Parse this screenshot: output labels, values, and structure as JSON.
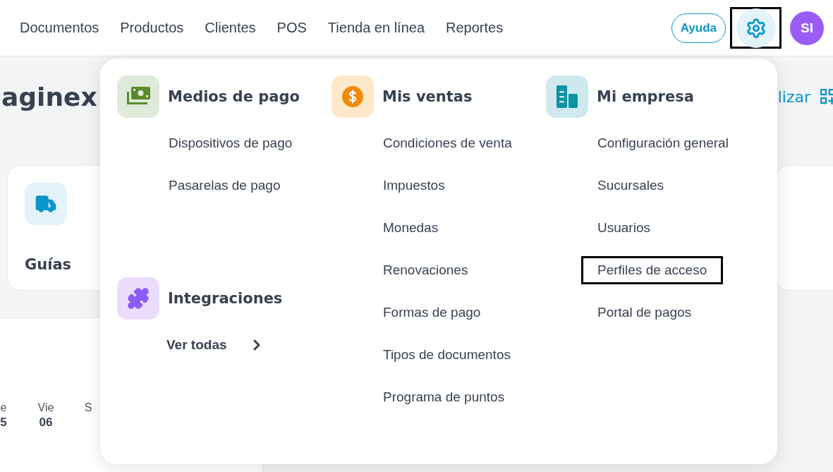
{
  "nav": {
    "links": [
      {
        "label": "Documentos"
      },
      {
        "label": "Productos"
      },
      {
        "label": "Clientes"
      },
      {
        "label": "POS"
      },
      {
        "label": "Tienda en línea"
      },
      {
        "label": "Reportes"
      }
    ],
    "help_button": "Ayuda",
    "settings": {
      "highlighted": true
    },
    "avatar": "SI"
  },
  "page": {
    "title": "aginex",
    "action": "lizar",
    "card": {
      "label": "Guías"
    },
    "days": [
      {
        "day": "e",
        "num": "5"
      },
      {
        "day": "Vie",
        "num": "06"
      },
      {
        "day": "S"
      }
    ]
  },
  "menu": {
    "columns": [
      [
        {
          "kind": "payments",
          "title": "Medios de pago",
          "items": [
            {
              "label": "Dispositivos de pago",
              "highlighted": false
            },
            {
              "label": "Pasarelas de pago",
              "highlighted": false
            }
          ]
        },
        {
          "kind": "integrations",
          "title": "Integraciones",
          "link": "Ver todas"
        }
      ],
      [
        {
          "kind": "sales",
          "title": "Mis ventas",
          "items": [
            {
              "label": "Condiciones de venta",
              "highlighted": false
            },
            {
              "label": "Impuestos",
              "highlighted": false
            },
            {
              "label": "Monedas",
              "highlighted": false
            },
            {
              "label": "Renovaciones",
              "highlighted": false
            },
            {
              "label": "Formas de pago",
              "highlighted": false
            },
            {
              "label": "Tipos de documentos",
              "highlighted": false
            },
            {
              "label": "Programa de puntos",
              "highlighted": false
            }
          ]
        }
      ],
      [
        {
          "kind": "company",
          "title": "Mi empresa",
          "items": [
            {
              "label": "Configuración general",
              "highlighted": false
            },
            {
              "label": "Sucursales",
              "highlighted": false
            },
            {
              "label": "Usuarios",
              "highlighted": false
            },
            {
              "label": "Perfiles de acceso",
              "highlighted": true
            },
            {
              "label": "Portal de pagos",
              "highlighted": false
            }
          ]
        }
      ]
    ]
  }
}
